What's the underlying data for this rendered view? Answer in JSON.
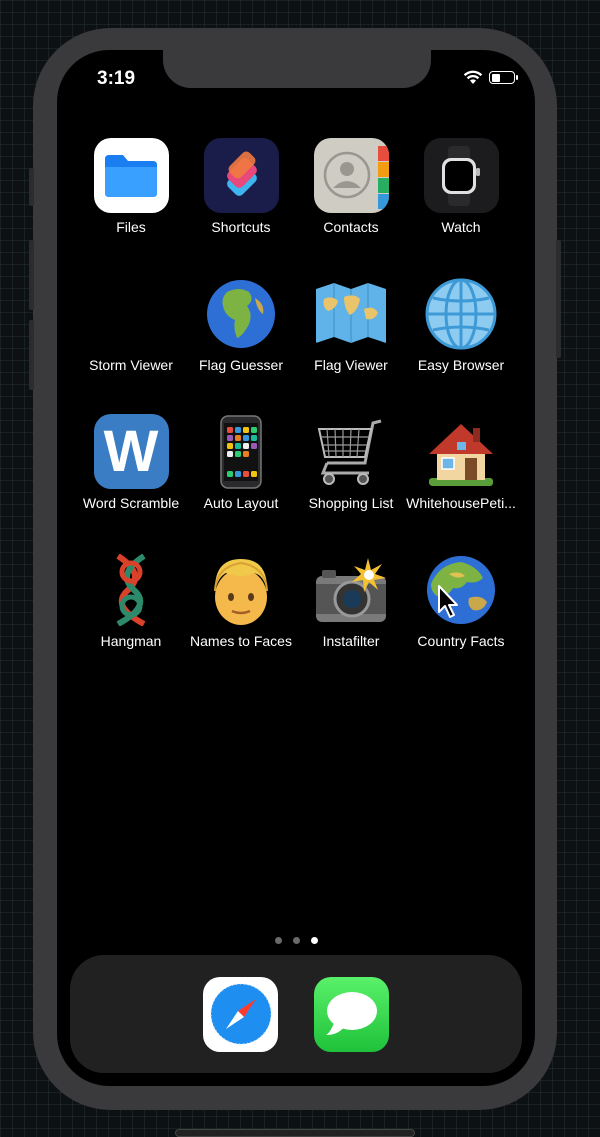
{
  "status_bar": {
    "time": "3:19"
  },
  "apps": [
    {
      "label": "Files",
      "icon": "files-icon"
    },
    {
      "label": "Shortcuts",
      "icon": "shortcuts-icon"
    },
    {
      "label": "Contacts",
      "icon": "contacts-icon"
    },
    {
      "label": "Watch",
      "icon": "watch-icon"
    },
    {
      "label": "Storm Viewer",
      "icon": "storm-cloud-icon",
      "glyph": "⛈"
    },
    {
      "label": "Flag Guesser",
      "icon": "globe-africa-icon",
      "glyph": "🌍"
    },
    {
      "label": "Flag Viewer",
      "icon": "world-map-icon",
      "glyph": "🗺"
    },
    {
      "label": "Easy Browser",
      "icon": "globe-meridians-icon",
      "glyph": "🌐"
    },
    {
      "label": "Word Scramble",
      "icon": "word-w-icon"
    },
    {
      "label": "Auto Layout",
      "icon": "mobile-phone-icon",
      "glyph": "📱"
    },
    {
      "label": "Shopping List",
      "icon": "shopping-cart-icon",
      "glyph": "🛒"
    },
    {
      "label": "WhitehousePeti...",
      "icon": "house-icon",
      "glyph": "🏠"
    },
    {
      "label": "Hangman",
      "icon": "knot-icon",
      "glyph": "🪢"
    },
    {
      "label": "Names to Faces",
      "icon": "man-face-icon",
      "glyph": "👨"
    },
    {
      "label": "Instafilter",
      "icon": "camera-flash-icon",
      "glyph": "📸"
    },
    {
      "label": "Country Facts",
      "icon": "globe-asia-icon",
      "glyph": "🌏"
    }
  ],
  "word_scramble_letter": "W",
  "dock": [
    {
      "icon": "safari-icon"
    },
    {
      "icon": "messages-icon"
    }
  ],
  "page_indicator": {
    "count": 3,
    "active_index": 2
  }
}
